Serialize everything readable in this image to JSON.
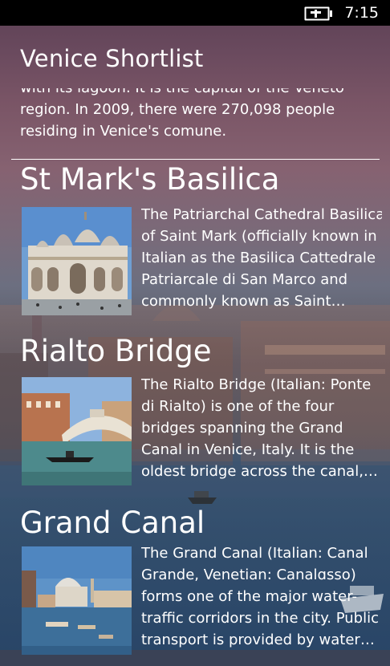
{
  "status_bar": {
    "time": "7:15",
    "battery_icon": "battery-charging-icon"
  },
  "app": {
    "title": "Venice Shortlist"
  },
  "intro": {
    "lines": [
      "with its lagoon. It is the capital of the Veneto",
      "region. In 2009, there were 270,098 people",
      "residing in Venice's comune."
    ]
  },
  "places": [
    {
      "title": "St Mark's Basilica",
      "thumb_icon": "basilica-photo",
      "desc_lines": [
        "The Patriarchal Cathedral Basilica",
        "of Saint Mark (officially known in",
        "Italian as the Basilica Cattedrale",
        "Patriarcale di San Marco and",
        "commonly known as Saint…"
      ]
    },
    {
      "title": "Rialto Bridge",
      "thumb_icon": "bridge-photo",
      "desc_lines": [
        "The Rialto Bridge (Italian: Ponte",
        "di Rialto) is one of the four",
        "bridges spanning the Grand",
        "Canal in Venice, Italy. It is the",
        "oldest bridge across the canal,…"
      ]
    },
    {
      "title": "Grand Canal",
      "thumb_icon": "canal-photo",
      "desc_lines": [
        "The Grand Canal (Italian: Canal",
        "Grande, Venetian: Canalɑsso)",
        "forms one of the major water-",
        "traffic corridors in the city. Public",
        "transport is provided by water…"
      ]
    }
  ]
}
